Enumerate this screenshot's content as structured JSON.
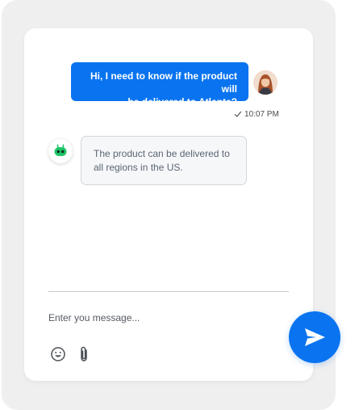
{
  "chat": {
    "messages": [
      {
        "sender": "user",
        "lines": [
          "Hi, I need to know if the product will",
          "be delivered to Atlanta?"
        ],
        "time": "10:07 PM",
        "status_icon": "check-icon"
      },
      {
        "sender": "bot",
        "lines": [
          "The product can be delivered to",
          "all regions in the US."
        ]
      }
    ]
  },
  "composer": {
    "placeholder": "Enter you message...",
    "emoji_icon": "smiley-icon",
    "attach_icon": "paperclip-icon",
    "send_icon": "paper-plane-icon"
  },
  "colors": {
    "accent": "#0a74f0",
    "bot_avatar_green": "#1fc46a",
    "bot_bubble_bg": "#f6f7f9",
    "backdrop": "#efefef"
  }
}
